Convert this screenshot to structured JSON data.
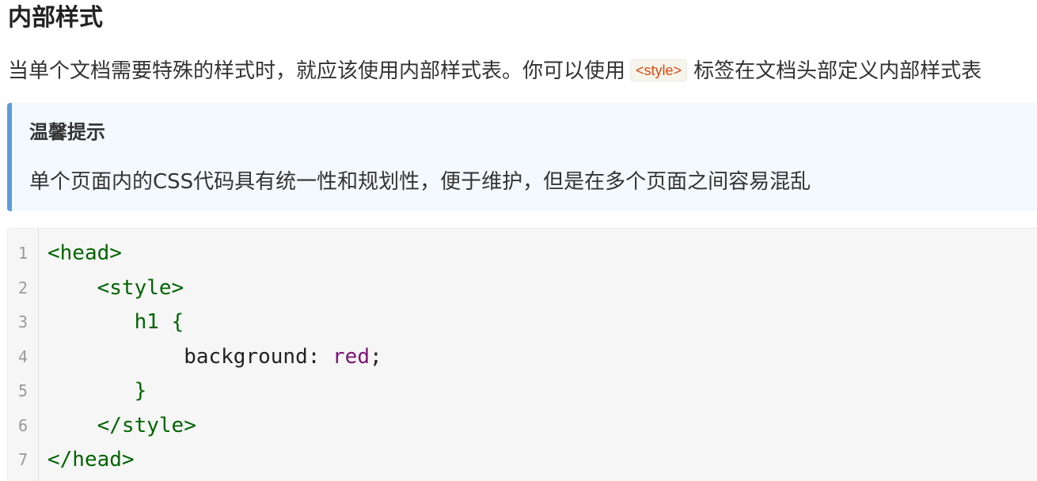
{
  "heading": "内部样式",
  "intro": {
    "before": "当单个文档需要特殊的样式时，就应该使用内部样式表。你可以使用",
    "code": "<style>",
    "after": "标签在文档头部定义内部样式表"
  },
  "tip": {
    "title": "温馨提示",
    "body": "单个页面内的CSS代码具有统一性和规划性，便于维护，但是在多个页面之间容易混乱"
  },
  "code_block": {
    "lines": [
      {
        "number": "1",
        "indent": "",
        "parts": [
          {
            "text": "<head>",
            "kind": "tag"
          }
        ]
      },
      {
        "number": "2",
        "indent": "    ",
        "parts": [
          {
            "text": "<style>",
            "kind": "tag"
          }
        ]
      },
      {
        "number": "3",
        "indent": "       ",
        "parts": [
          {
            "text": "h1 {",
            "kind": "tag"
          }
        ]
      },
      {
        "number": "4",
        "indent": "           ",
        "parts": [
          {
            "text": "background: ",
            "kind": "plain"
          },
          {
            "text": "red",
            "kind": "val"
          },
          {
            "text": ";",
            "kind": "plain"
          }
        ]
      },
      {
        "number": "5",
        "indent": "       ",
        "parts": [
          {
            "text": "}",
            "kind": "tag"
          }
        ]
      },
      {
        "number": "6",
        "indent": "    ",
        "parts": [
          {
            "text": "</style>",
            "kind": "tag"
          }
        ]
      },
      {
        "number": "7",
        "indent": "",
        "parts": [
          {
            "text": "</head>",
            "kind": "tag"
          }
        ]
      }
    ]
  },
  "colors": {
    "tip_border": "#5b9be0",
    "tip_background": "#f3f9fe",
    "code_tag": "#006400",
    "code_value": "#7a1277",
    "inline_code_text": "#d6490c"
  }
}
